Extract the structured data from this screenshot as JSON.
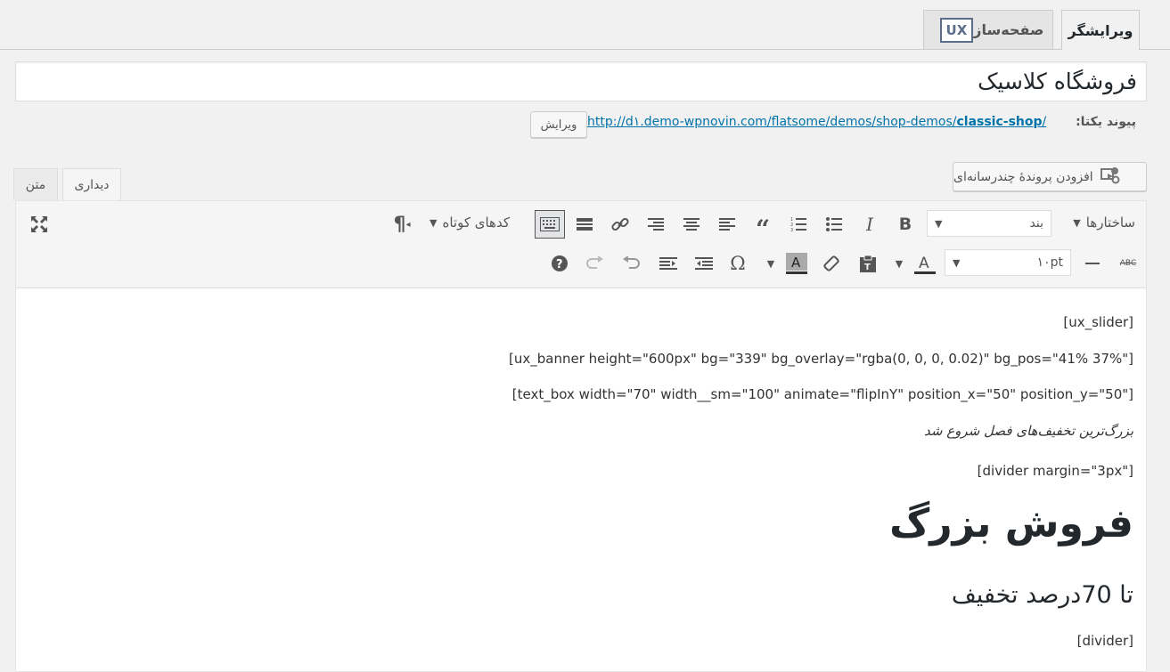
{
  "builder_tabs": {
    "editor": "ویرایشگر",
    "page_builder": "صفحه‌ساز",
    "ux_badge": "UX"
  },
  "post": {
    "title": "فروشگاه کلاسیک",
    "permalink_label": "پیوند یکتا:",
    "permalink_url_prefix": "http://d۱.demo-wpnovin.com/flatsome/demos/shop-demos/",
    "permalink_slug": "classic-shop",
    "permalink_suffix": "/",
    "edit_button": "ویرایش"
  },
  "media": {
    "add_media_label": "افزودن پروندهٔ چندرسانه‌ای",
    "icon": "media-icon"
  },
  "editor_tabs": {
    "visual": "دیداری",
    "text": "متن"
  },
  "toolbar": {
    "formats_label": "ساختارها",
    "paragraph_select": "بند",
    "shortcodes_label": "کدهای کوتاه",
    "font_size_select": "۱۰pt",
    "row1_icons": [
      "bold-icon",
      "italic-icon",
      "bullet-list-icon",
      "numbered-list-icon",
      "blockquote-icon",
      "align-left-icon",
      "align-center-icon",
      "align-right-icon",
      "link-icon",
      "read-more-icon",
      "toolbar-toggle-icon",
      "paragraph-rtl-icon",
      "fullscreen-icon"
    ],
    "row2_icons": [
      "strikethrough-icon",
      "horizontal-line-icon",
      "text-color-icon",
      "paste-text-icon",
      "clear-formatting-icon",
      "background-color-icon",
      "special-character-icon",
      "outdent-icon",
      "indent-icon",
      "undo-icon",
      "redo-icon",
      "help-icon"
    ]
  },
  "content": {
    "line1": "[ux_slider]",
    "line2": "[ux_banner height=\"600px\" bg=\"339\" bg_overlay=\"rgba(0, 0, 0, 0.02)\" bg_pos=\"41% 37%\"]",
    "line3": "[text_box width=\"70\" width__sm=\"100\" animate=\"flipInY\" position_x=\"50\" position_y=\"50\"]",
    "line4": "بزرگ‌ترین تخفیف‌های فصل شروع شد",
    "line5": "[divider margin=\"3px\"]",
    "heading": "فروش بزرگ",
    "subheading": "تا 70درصد تخفیف",
    "line6": "[divider]"
  },
  "colors": {
    "link": "#0073aa",
    "ux_badge": "#5b6f8a"
  }
}
